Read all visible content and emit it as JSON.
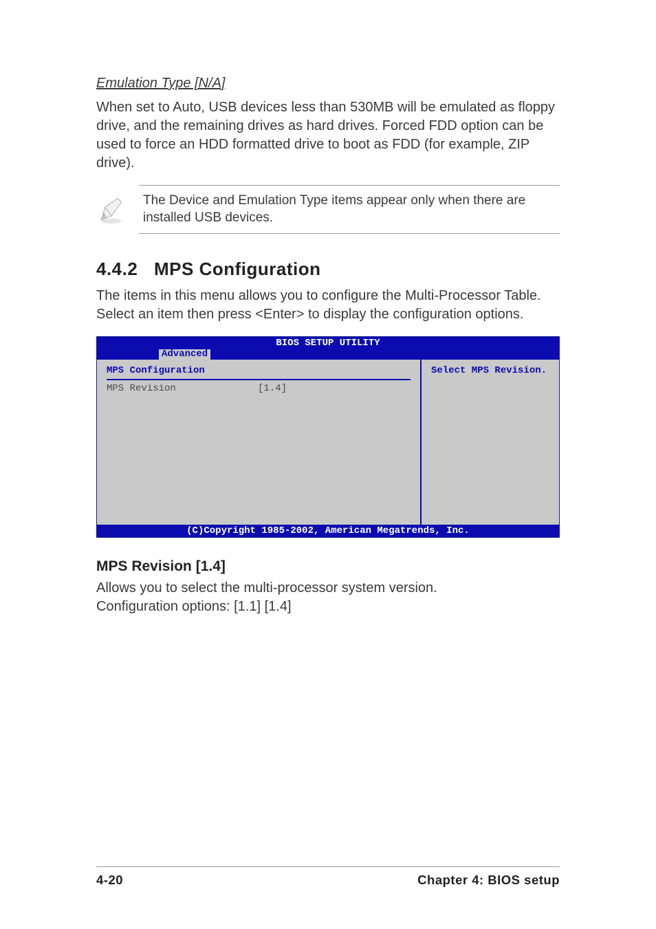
{
  "section1": {
    "heading": "Emulation Type [N/A]",
    "body": "When set to Auto, USB devices less than 530MB will be emulated as floppy drive, and the remaining drives as hard drives. Forced FDD option can be used to force an HDD formatted drive to boot as FDD (for example, ZIP drive)."
  },
  "note": {
    "text": "The Device and Emulation Type items appear only when there are installed USB devices."
  },
  "section2": {
    "number": "4.4.2",
    "title": "MPS Configuration",
    "intro": "The items in this menu allows you to configure the Multi-Processor Table. Select an item then press <Enter> to display the configuration options."
  },
  "bios": {
    "header": "BIOS SETUP UTILITY",
    "tab": "Advanced",
    "section_title": "MPS Configuration",
    "item_label": "MPS Revision",
    "item_value": "[1.4]",
    "help_text": "Select MPS Revision.",
    "footer": "(C)Copyright 1985-2002, American Megatrends, Inc."
  },
  "section3": {
    "heading": "MPS Revision [1.4]",
    "line1": "Allows you to select the multi-processor system version.",
    "line2": "Configuration options: [1.1] [1.4]"
  },
  "footer": {
    "page": "4-20",
    "chapter": "Chapter 4: BIOS setup"
  },
  "chart_data": {
    "type": "table",
    "title": "MPS Configuration",
    "rows": [
      {
        "setting": "MPS Revision",
        "value": "[1.4]"
      }
    ],
    "help": "Select MPS Revision.",
    "configuration_options": [
      "1.1",
      "1.4"
    ]
  }
}
